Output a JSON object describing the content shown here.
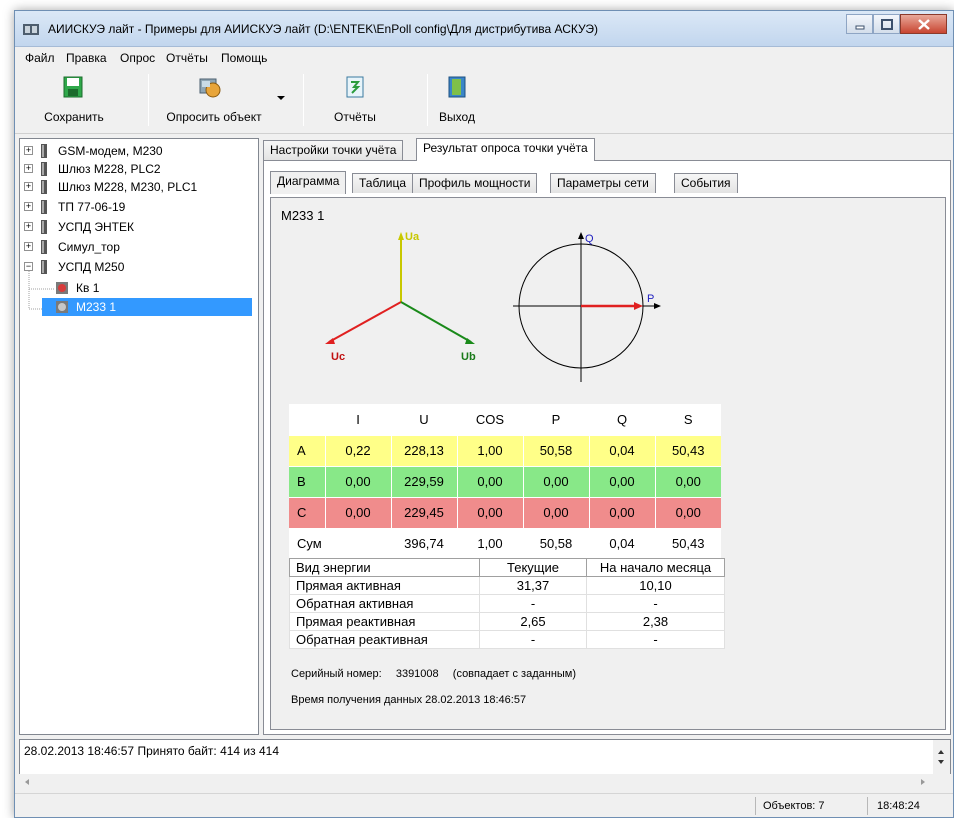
{
  "window": {
    "title": "АИИСКУЭ лайт - Примеры для АИИСКУЭ лайт (D:\\ENTEK\\EnPoll config\\Для дистрибутива АСКУЭ)"
  },
  "menu": [
    "Файл",
    "Правка",
    "Опрос",
    "Отчёты",
    "Помощь"
  ],
  "toolbar": {
    "save": "Сохранить",
    "poll": "Опросить объект",
    "reports": "Отчёты",
    "exit": "Выход"
  },
  "tree": [
    {
      "label": "GSM-модем, M230",
      "expander": "+"
    },
    {
      "label": "Шлюз М228, PLC2",
      "expander": "+"
    },
    {
      "label": "Шлюз М228, М230, PLC1",
      "expander": "+"
    },
    {
      "label": "ТП 77-06-19",
      "expander": "+"
    },
    {
      "label": "УСПД ЭНТЕК",
      "expander": "+"
    },
    {
      "label": "Симул_тор",
      "expander": "+"
    },
    {
      "label": "УСПД М250",
      "expander": "−"
    },
    {
      "label": "Кв 1"
    },
    {
      "label": "М233 1"
    }
  ],
  "outer_tabs": [
    "Настройки точки учёта",
    "Результат опроса точки учёта"
  ],
  "inner_tabs": [
    "Диаграмма",
    "Таблица",
    "Профиль мощности",
    "Параметры сети",
    "События"
  ],
  "device": "М233 1",
  "diagram": {
    "ua": "Ua",
    "ub": "Ub",
    "uc": "Uc",
    "p": "P",
    "q": "Q"
  },
  "measurements": {
    "headers": [
      "",
      "I",
      "U",
      "COS",
      "P",
      "Q",
      "S"
    ],
    "rows": [
      [
        "A",
        "0,22",
        "228,13",
        "1,00",
        "50,58",
        "0,04",
        "50,43"
      ],
      [
        "B",
        "0,00",
        "229,59",
        "0,00",
        "0,00",
        "0,00",
        "0,00"
      ],
      [
        "C",
        "0,00",
        "229,45",
        "0,00",
        "0,00",
        "0,00",
        "0,00"
      ],
      [
        "Сум",
        "",
        "396,74",
        "1,00",
        "50,58",
        "0,04",
        "50,43"
      ]
    ]
  },
  "energy": {
    "headers": [
      "Вид энергии",
      "Текущие",
      "На начало месяца"
    ],
    "rows": [
      [
        "Прямая активная",
        "31,37",
        "10,10"
      ],
      [
        "Обратная активная",
        "-",
        "-"
      ],
      [
        "Прямая реактивная",
        "2,65",
        "2,38"
      ],
      [
        "Обратная реактивная",
        "-",
        "-"
      ]
    ]
  },
  "serial": {
    "label": "Серийный номер:",
    "value": "3391008",
    "note": "(совпадает с заданным)"
  },
  "received": {
    "label": "Время получения данных",
    "value": "28.02.2013 18:46:57"
  },
  "log": "28.02.2013 18:46:57  Принято байт: 414 из 414",
  "status": {
    "objects": "Объектов: 7",
    "time": "18:48:24"
  },
  "colors": {
    "phase_a": "#ffff88",
    "phase_b": "#88e888",
    "phase_c": "#f08c8c",
    "selection": "#3399ff"
  }
}
